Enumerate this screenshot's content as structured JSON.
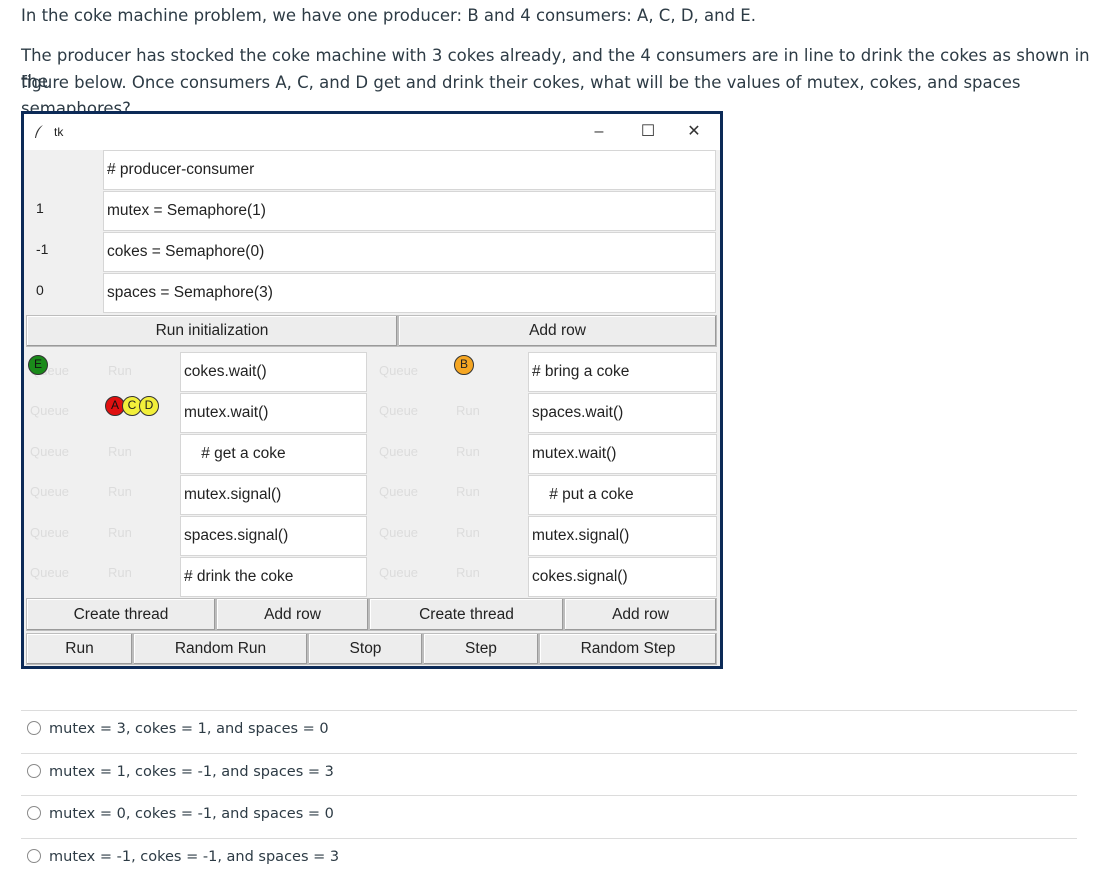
{
  "question": {
    "line1": "In the coke machine problem, we have one producer: B and 4 consumers: A, C, D, and E.",
    "line2": "The producer has stocked the coke machine with 3 cokes already, and the 4 consumers are in line to drink the cokes as shown in the",
    "line3": "figure below. Once consumers A, C, and D get and drink their cokes, what will be the values of mutex, cokes, and spaces semaphores?"
  },
  "window": {
    "title": "tk",
    "minimize": "–",
    "maximize": "☐",
    "close": "✕"
  },
  "init": {
    "header": "# producer-consumer",
    "rows": [
      {
        "value": "1",
        "code": "mutex = Semaphore(1)"
      },
      {
        "value": "-1",
        "code": "cokes = Semaphore(0)"
      },
      {
        "value": "0",
        "code": "spaces = Semaphore(3)"
      }
    ],
    "run_button": "Run initialization",
    "add_row_button": "Add row"
  },
  "consumer": {
    "code": [
      "cokes.wait()",
      "mutex.wait()",
      "    # get a coke",
      "mutex.signal()",
      "spaces.signal()",
      "# drink the coke"
    ],
    "create_thread": "Create thread",
    "add_row": "Add row",
    "queue_label": "Queue",
    "run_label": "Run",
    "tokens": {
      "e": "E",
      "a": "A",
      "c": "C",
      "d": "D"
    }
  },
  "producer": {
    "code": [
      "# bring a coke",
      "spaces.wait()",
      "mutex.wait()",
      "    # put a coke",
      "mutex.signal()",
      "cokes.signal()"
    ],
    "create_thread": "Create thread",
    "add_row": "Add row",
    "queue_label": "Queue",
    "run_label": "Run",
    "tokens": {
      "b": "B"
    }
  },
  "controls": {
    "run": "Run",
    "random_run": "Random Run",
    "stop": "Stop",
    "step": "Step",
    "random_step": "Random Step"
  },
  "options": [
    "mutex = 3, cokes = 1, and spaces = 0",
    "mutex = 1, cokes = -1, and spaces = 3",
    "mutex = 0, cokes = -1, and spaces = 0",
    "mutex = -1, cokes = -1, and spaces = 3"
  ],
  "colors": {
    "window_border": "#0c2a57",
    "token_e": "#1a8a1a",
    "token_a": "#e01010",
    "token_c": "#f2ef3a",
    "token_d": "#f2ef3a",
    "token_b": "#f5a623"
  }
}
